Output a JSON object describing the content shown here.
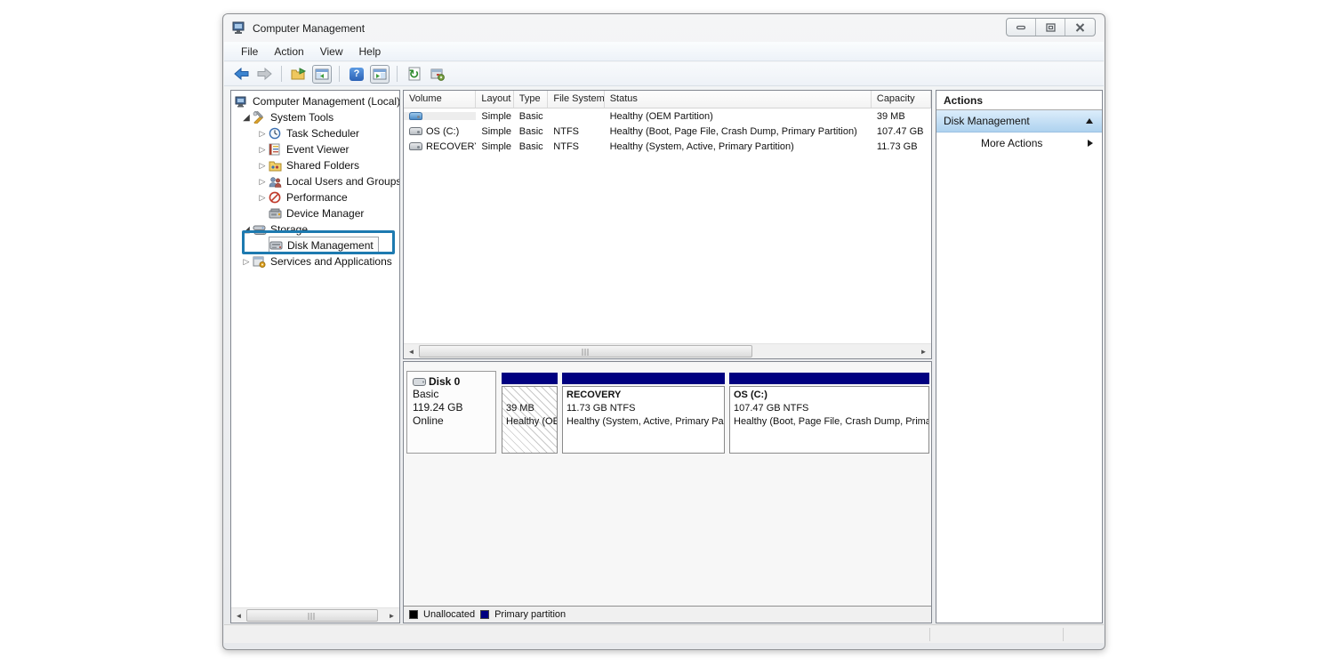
{
  "window": {
    "title": "Computer Management",
    "controls": {
      "minimize": "minimize",
      "restore": "restore",
      "close": "close"
    }
  },
  "menu": {
    "file": "File",
    "action": "Action",
    "view": "View",
    "help": "Help"
  },
  "toolbar": {
    "icons": [
      "back-arrow",
      "forward-arrow",
      "export-folder",
      "show-console-tree",
      "help",
      "show-action-pane",
      "refresh",
      "properties"
    ],
    "help_glyph": "?",
    "refresh_glyph": "↻"
  },
  "icons": {
    "expander_expanded": "◢",
    "expander_collapsed": "▷"
  },
  "tree": {
    "items": {
      "0": {
        "label": "Computer Management (Local)"
      },
      "1": {
        "label": "System Tools"
      },
      "2": {
        "label": "Task Scheduler"
      },
      "3": {
        "label": "Event Viewer"
      },
      "4": {
        "label": "Shared Folders"
      },
      "5": {
        "label": "Local Users and Groups"
      },
      "6": {
        "label": "Performance"
      },
      "7": {
        "label": "Device Manager"
      },
      "8": {
        "label": "Storage"
      },
      "9": {
        "label": "Disk Management"
      },
      "10": {
        "label": "Services and Applications"
      }
    },
    "annotation_color": "#1d7ab0"
  },
  "volume_list": {
    "columns": {
      "volume": "Volume",
      "layout": "Layout",
      "type": "Type",
      "file_system": "File System",
      "status": "Status",
      "capacity": "Capacity"
    },
    "rows": {
      "0": {
        "volume": "",
        "layout": "Simple",
        "type": "Basic",
        "file_system": "",
        "status": "Healthy (OEM Partition)",
        "capacity": "39 MB"
      },
      "1": {
        "volume": "OS (C:)",
        "layout": "Simple",
        "type": "Basic",
        "file_system": "NTFS",
        "status": "Healthy (Boot, Page File, Crash Dump, Primary Partition)",
        "capacity": "107.47 GB"
      },
      "2": {
        "volume": "RECOVERY",
        "layout": "Simple",
        "type": "Basic",
        "file_system": "NTFS",
        "status": "Healthy (System, Active, Primary Partition)",
        "capacity": "11.73 GB"
      }
    }
  },
  "disk_view": {
    "disk0": {
      "name": "Disk 0",
      "type": "Basic",
      "size": "119.24 GB",
      "status": "Online"
    },
    "partitions": {
      "0": {
        "label": "",
        "size": "39 MB",
        "status": "Healthy (OEM Partition)",
        "selected": true
      },
      "1": {
        "label": "RECOVERY",
        "size": "11.73 GB NTFS",
        "status": "Healthy (System, Active, Primary Partition)"
      },
      "2": {
        "label": "OS (C:)",
        "size": "107.47 GB NTFS",
        "status": "Healthy (Boot, Page File, Crash Dump, Primary Partition)"
      }
    },
    "legend": {
      "unallocated": {
        "label": "Unallocated",
        "color": "#000000"
      },
      "primary": {
        "label": "Primary partition",
        "color": "#000080"
      }
    },
    "primary_partition_color": "#000080"
  },
  "actions_pane": {
    "header": "Actions",
    "group_title": "Disk Management",
    "more_actions": "More Actions"
  }
}
